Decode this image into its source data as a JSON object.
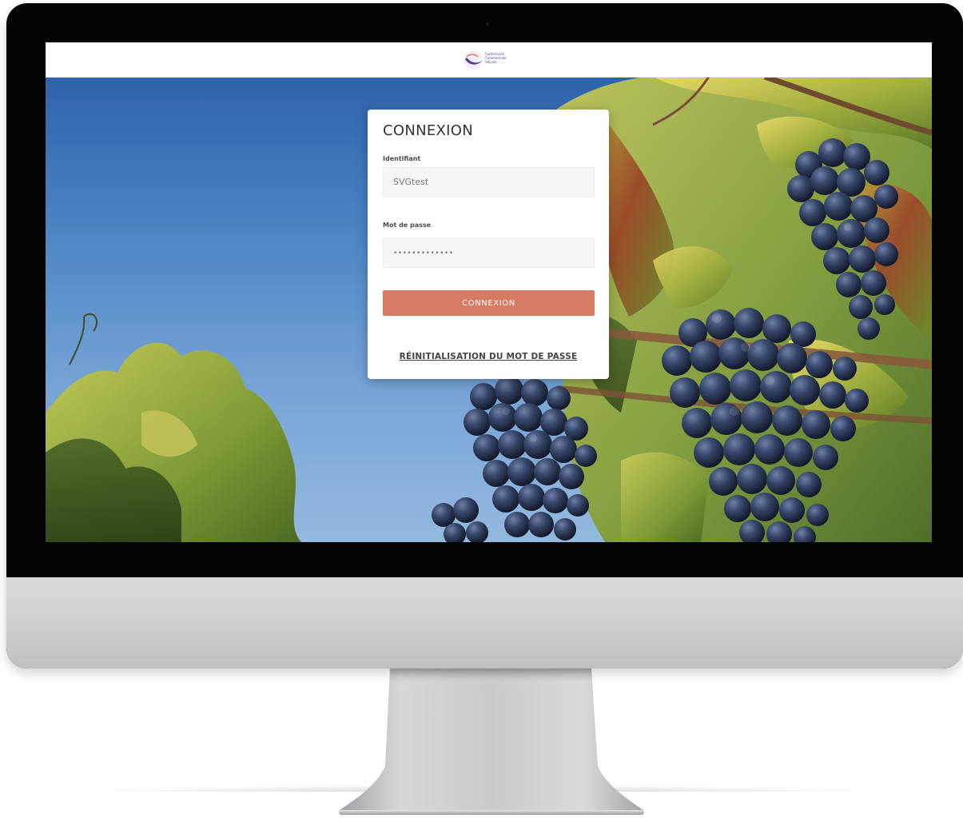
{
  "header": {
    "logo_lines": [
      "Commission",
      "Commerciale",
      "Viticole"
    ],
    "logo_icon": "swoosh-logo-icon"
  },
  "login": {
    "title": "CONNEXION",
    "username_label": "Identifiant",
    "username_value": "SVGtest",
    "password_label": "Mot de passe",
    "password_value": "•••••••••••••",
    "submit_label": "CONNEXION",
    "reset_link": "RÉINITIALISATION DU MOT DE PASSE"
  },
  "colors": {
    "accent": "#d77b64",
    "brand_purple": "#4f3f86",
    "sky_top": "#2f62ab",
    "sky_bottom": "#94b9df",
    "grape": "#2c3a57"
  },
  "device": {
    "type": "desktop-monitor",
    "camera_icon": "camera-dot-icon"
  }
}
